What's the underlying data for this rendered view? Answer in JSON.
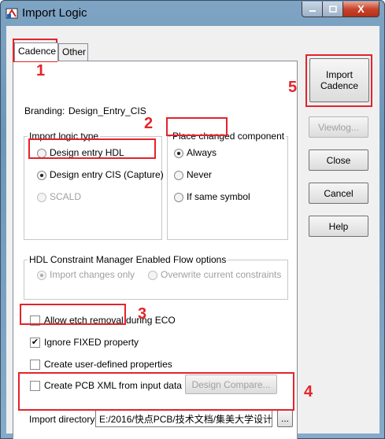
{
  "window": {
    "title": "Import Logic",
    "close_glyph": "X"
  },
  "tabs": [
    {
      "label": "Cadence"
    },
    {
      "label": "Other"
    }
  ],
  "branding": {
    "label": "Branding:",
    "value": "Design_Entry_CIS"
  },
  "import_logic_type": {
    "title": "Import logic type",
    "options": [
      {
        "label": "Design entry HDL"
      },
      {
        "label": "Design entry CIS (Capture)"
      },
      {
        "label": "SCALD"
      }
    ]
  },
  "place_changed": {
    "title": "Place changed component",
    "options": [
      {
        "label": "Always"
      },
      {
        "label": "Never"
      },
      {
        "label": "If same symbol"
      }
    ]
  },
  "hdl_constraint": {
    "title": "HDL Constraint Manager Enabled Flow options",
    "options": [
      {
        "label": "Import changes only"
      },
      {
        "label": "Overwrite current constraints"
      }
    ]
  },
  "checkboxes": [
    {
      "label": "Allow etch removal during ECO"
    },
    {
      "label": "Ignore FIXED property",
      "check": "✔"
    },
    {
      "label": "Create user-defined properties"
    },
    {
      "label": "Create PCB XML from input data"
    }
  ],
  "design_compare_label": "Design Compare...",
  "import_directory": {
    "label": "Import directory:",
    "value": "E:/2016/快点PCB/技术文档/集美大学设计",
    "browse": "..."
  },
  "buttons": {
    "import_cadence_line1": "Import",
    "import_cadence_line2": "Cadence",
    "viewlog": "Viewlog...",
    "close": "Close",
    "cancel": "Cancel",
    "help": "Help"
  },
  "annotations": [
    "1",
    "2",
    "3",
    "4",
    "5"
  ],
  "colors": {
    "annotation": "#e3242b"
  }
}
